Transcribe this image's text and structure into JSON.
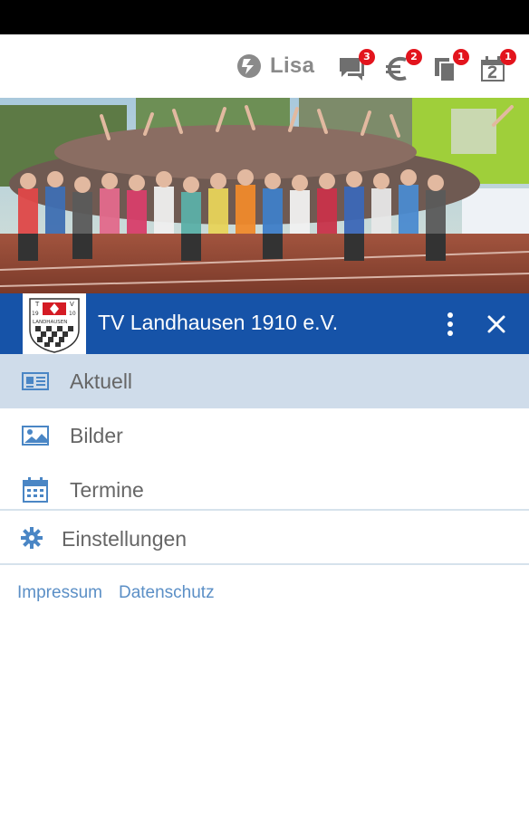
{
  "user": {
    "name": "Lisa"
  },
  "notifications": {
    "chat": {
      "icon": "chat-icon",
      "count": "3"
    },
    "payments": {
      "icon": "euro-icon",
      "count": "2"
    },
    "documents": {
      "icon": "documents-icon",
      "count": "1"
    },
    "calendar": {
      "icon": "calendar-icon",
      "count": "1"
    }
  },
  "club": {
    "name": "TV Landhausen 1910 e.V.",
    "logo_text": [
      "T",
      "V",
      "19",
      "10",
      "LANDHAUSEN"
    ]
  },
  "menu": {
    "items": [
      {
        "label": "Aktuell",
        "icon": "news-icon",
        "active": true
      },
      {
        "label": "Bilder",
        "icon": "image-icon",
        "active": false
      },
      {
        "label": "Termine",
        "icon": "calendar-icon",
        "active": false
      }
    ],
    "settings": {
      "label": "Einstellungen",
      "icon": "gear-icon"
    }
  },
  "footer": {
    "impressum": "Impressum",
    "datenschutz": "Datenschutz"
  },
  "colors": {
    "primary": "#1653a8",
    "active_bg": "#cfdcea",
    "badge": "#e3141d",
    "link": "#5b8fc6",
    "icon": "#4a86c5"
  }
}
